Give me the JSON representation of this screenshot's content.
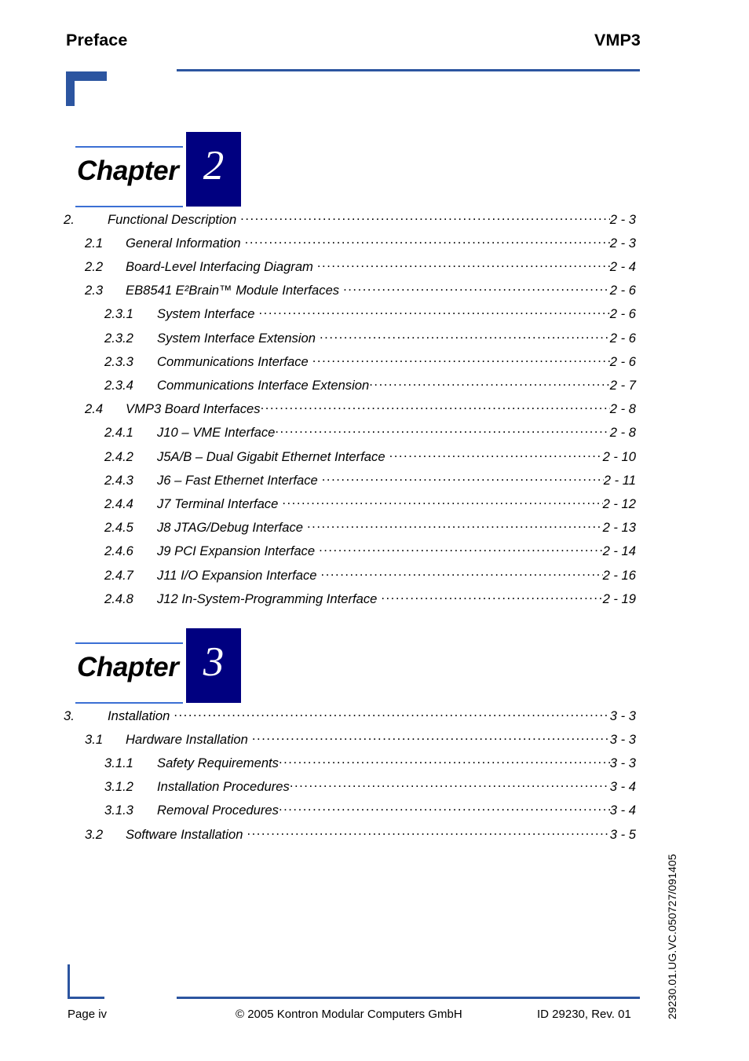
{
  "header": {
    "left_title": "Preface",
    "right_title": "VMP3"
  },
  "footer": {
    "page_label": "Page iv",
    "copyright": "© 2005 Kontron Modular Computers GmbH",
    "doc_id": "ID 29230, Rev. 01",
    "side_id": "29230.01.UG.VC.050727/091405"
  },
  "colors": {
    "rule_blue": "#2C55A0",
    "chapter_rule_blue": "#3B6FD4",
    "chapter_box_navy": "#000080"
  },
  "chapters": [
    {
      "word": "Chapter",
      "number": "2",
      "entries": [
        {
          "level": 1,
          "num": "2.",
          "title": "Functional Description",
          "page": "2 - 3",
          "gap": true
        },
        {
          "level": 2,
          "num": "2.1",
          "title": "General Information",
          "page": "2 - 3",
          "gap": true
        },
        {
          "level": 2,
          "num": "2.2",
          "title": "Board-Level Interfacing Diagram",
          "page": "2 - 4",
          "gap": true
        },
        {
          "level": 2,
          "num": "2.3",
          "title": "EB8541 E²Brain™ Module Interfaces",
          "page": "2 - 6",
          "gap": true
        },
        {
          "level": 3,
          "num": "2.3.1",
          "title": "System Interface",
          "page": "2 - 6",
          "gap": true
        },
        {
          "level": 3,
          "num": "2.3.2",
          "title": "System Interface Extension",
          "page": "2 - 6",
          "gap": true
        },
        {
          "level": 3,
          "num": "2.3.3",
          "title": "Communications Interface",
          "page": "2 - 6",
          "gap": true
        },
        {
          "level": 3,
          "num": "2.3.4",
          "title": "Communications Interface Extension",
          "page": "2 - 7",
          "gap": false
        },
        {
          "level": 2,
          "num": "2.4",
          "title": "VMP3 Board Interfaces",
          "page": "2 - 8",
          "gap": false
        },
        {
          "level": 3,
          "num": "2.4.1",
          "title": "J10 – VME Interface",
          "page": "2 - 8",
          "gap": false
        },
        {
          "level": 3,
          "num": "2.4.2",
          "title": "J5A/B – Dual Gigabit Ethernet Interface",
          "page": "2 - 10",
          "gap": true
        },
        {
          "level": 3,
          "num": "2.4.3",
          "title": "J6 – Fast Ethernet Interface",
          "page": "2 - 11",
          "gap": true
        },
        {
          "level": 3,
          "num": "2.4.4",
          "title": "J7 Terminal Interface",
          "page": "2 - 12",
          "gap": true
        },
        {
          "level": 3,
          "num": "2.4.5",
          "title": "J8 JTAG/Debug Interface",
          "page": "2 - 13",
          "gap": true
        },
        {
          "level": 3,
          "num": "2.4.6",
          "title": "J9 PCI Expansion Interface",
          "page": "2 - 14",
          "gap": true
        },
        {
          "level": 3,
          "num": "2.4.7",
          "title": "J11 I/O Expansion Interface",
          "page": "2 - 16",
          "gap": true
        },
        {
          "level": 3,
          "num": "2.4.8",
          "title": "J12 In-System-Programming Interface",
          "page": "2 - 19",
          "gap": true
        }
      ]
    },
    {
      "word": "Chapter",
      "number": "3",
      "entries": [
        {
          "level": 1,
          "num": "3.",
          "title": "Installation",
          "page": "3 - 3",
          "gap": true
        },
        {
          "level": 2,
          "num": "3.1",
          "title": "Hardware Installation",
          "page": "3 - 3",
          "gap": true
        },
        {
          "level": 3,
          "num": "3.1.1",
          "title": "Safety Requirements",
          "page": "3 - 3",
          "gap": false
        },
        {
          "level": 3,
          "num": "3.1.2",
          "title": "Installation Procedures",
          "page": "3 - 4",
          "gap": false
        },
        {
          "level": 3,
          "num": "3.1.3",
          "title": "Removal Procedures",
          "page": "3 - 4",
          "gap": false
        },
        {
          "level": 2,
          "num": "3.2",
          "title": "Software Installation",
          "page": "3 - 5",
          "gap": true
        }
      ]
    }
  ]
}
